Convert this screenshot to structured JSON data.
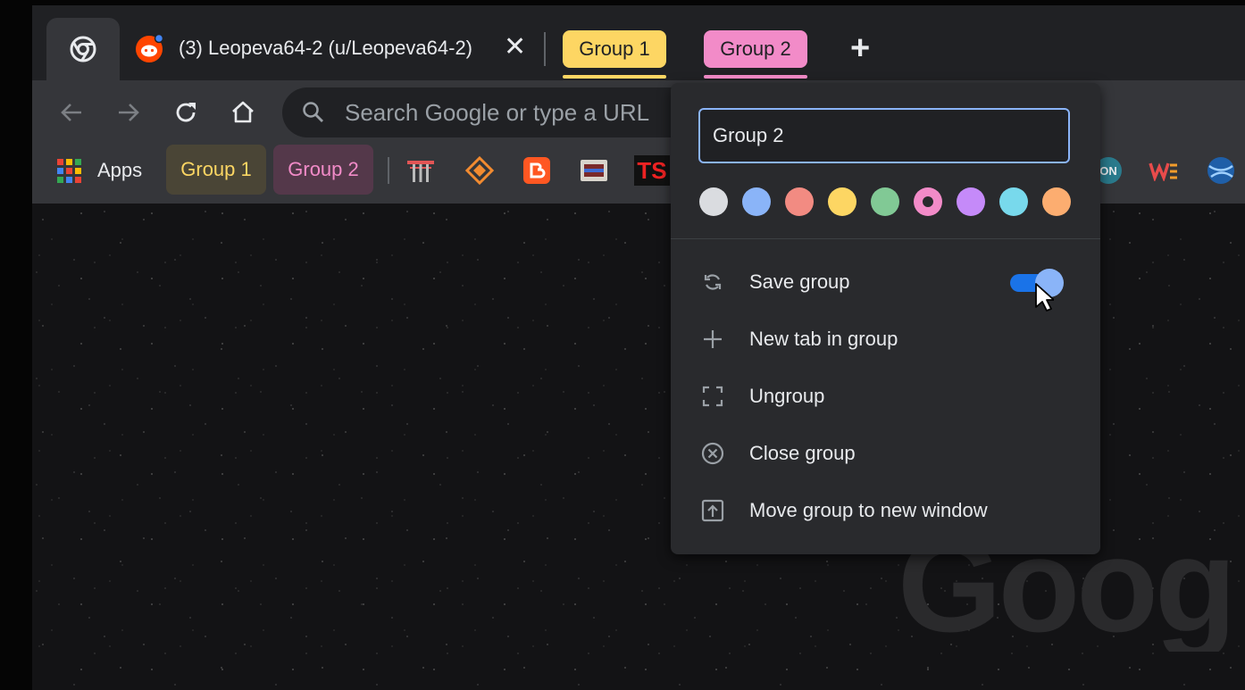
{
  "tabs": {
    "reddit_title": "(3) Leopeva64-2 (u/Leopeva64-2)",
    "close_symbol": "✕",
    "groups": [
      {
        "label": "Group 1",
        "color": "#fdd663"
      },
      {
        "label": "Group 2",
        "color": "#f28bc8"
      }
    ],
    "new_tab_symbol": "+"
  },
  "omnibox": {
    "placeholder": "Search Google or type a URL"
  },
  "bookmarks": {
    "apps_label": "Apps",
    "groups": [
      {
        "label": "Group 1",
        "bg": "#4a4536",
        "fg": "#fdd663"
      },
      {
        "label": "Group 2",
        "bg": "#54384a",
        "fg": "#f28bc8"
      }
    ],
    "icons": [
      "torii-gate-icon",
      "diamond-icon",
      "blogger-icon",
      "tv-icon",
      "ts-icon",
      "on-icon",
      "ws-icon",
      "globe-icon"
    ],
    "ts_text": "TS",
    "on_text": "ON"
  },
  "group_editor": {
    "name_value": "Group 2",
    "colors": [
      {
        "name": "grey",
        "hex": "#dadce0"
      },
      {
        "name": "blue",
        "hex": "#8ab4f8"
      },
      {
        "name": "red",
        "hex": "#f28b82"
      },
      {
        "name": "yellow",
        "hex": "#fdd663"
      },
      {
        "name": "green",
        "hex": "#81c995"
      },
      {
        "name": "pink",
        "hex": "#f28bc8",
        "selected": true
      },
      {
        "name": "purple",
        "hex": "#c58af9"
      },
      {
        "name": "cyan",
        "hex": "#78d9ec"
      },
      {
        "name": "orange",
        "hex": "#fcad70"
      }
    ],
    "items": [
      {
        "label": "Save group",
        "icon": "sync-icon",
        "toggle_on": true
      },
      {
        "label": "New tab in group",
        "icon": "plus-icon"
      },
      {
        "label": "Ungroup",
        "icon": "ungroup-icon"
      },
      {
        "label": "Close group",
        "icon": "close-circle-icon"
      },
      {
        "label": "Move group to new window",
        "icon": "open-in-new-window-icon"
      }
    ]
  },
  "background": {
    "watermark": "Goog"
  }
}
